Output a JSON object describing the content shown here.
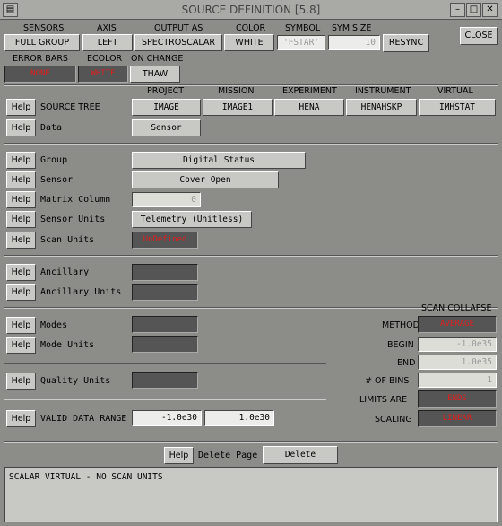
{
  "window": {
    "title": "SOURCE DEFINITION    [5.8]",
    "min_glyph": "–",
    "max_glyph": "□",
    "close_glyph": "✕"
  },
  "top_headers": {
    "sensors": "SENSORS",
    "axis": "AXIS",
    "output_as": "OUTPUT AS",
    "color": "COLOR",
    "symbol": "SYMBOL",
    "sym_size": "SYM SIZE"
  },
  "top_values": {
    "sensors": "FULL GROUP",
    "axis": "LEFT",
    "output_as": "SPECTROSCALAR",
    "color": "WHITE",
    "symbol": "'FSTAR'",
    "sym_size": "10",
    "resync": "RESYNC",
    "close": "CLOSE"
  },
  "second_headers": {
    "error_bars": "ERROR BARS",
    "ecolor": "ECOLOR",
    "on_change": "ON CHANGE"
  },
  "second_values": {
    "error_bars": "NONE",
    "ecolor": "WHITE",
    "on_change": "THAW"
  },
  "col_headers": {
    "project": "PROJECT",
    "mission": "MISSION",
    "experiment": "EXPERIMENT",
    "instrument": "INSTRUMENT",
    "virtual": "VIRTUAL"
  },
  "help_label": "Help",
  "source_tree": {
    "label": "SOURCE TREE",
    "project": "IMAGE",
    "mission": "IMAGE1",
    "experiment": "HENA",
    "instrument": "HENAHSKP",
    "virtual": "IMHSTAT"
  },
  "data_row": {
    "label": "Data",
    "value": "Sensor"
  },
  "group": {
    "label": "Group",
    "value": "Digital Status"
  },
  "sensor": {
    "label": "Sensor",
    "value": "Cover Open"
  },
  "matrix_column": {
    "label": "Matrix Column",
    "value": "0"
  },
  "sensor_units": {
    "label": "Sensor Units",
    "value": "Telemetry (Unitless)"
  },
  "scan_units": {
    "label": "Scan Units",
    "value": "UnDefined"
  },
  "ancillary": {
    "label": "Ancillary"
  },
  "ancillary_units": {
    "label": "Ancillary Units"
  },
  "modes": {
    "label": "Modes"
  },
  "mode_units": {
    "label": "Mode Units"
  },
  "quality_units": {
    "label": "Quality Units"
  },
  "valid_range": {
    "label": "VALID DATA RANGE",
    "min": "-1.0e30",
    "max": "1.0e30"
  },
  "scan_collapse": {
    "title": "SCAN COLLAPSE",
    "method_label": "METHOD",
    "method_value": "AVERAGE",
    "begin_label": "BEGIN",
    "begin_value": "-1.0e35",
    "end_label": "END",
    "end_value": "1.0e35",
    "bins_label": "# OF BINS",
    "bins_value": "1",
    "limits_label": "LIMITS ARE",
    "limits_value": "ENDS",
    "scaling_label": "SCALING",
    "scaling_value": "LINEAR"
  },
  "footer": {
    "delete_page_label": "Delete Page",
    "delete_button": "Delete"
  },
  "status_text": "SCALAR VIRTUAL - NO SCAN UNITS"
}
